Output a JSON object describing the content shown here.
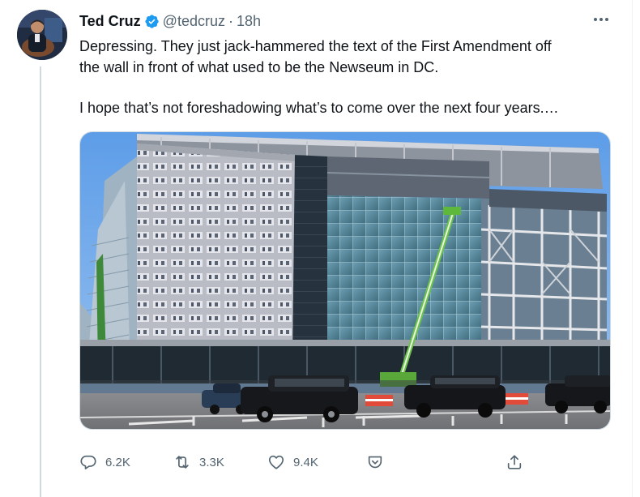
{
  "tweet": {
    "author_name": "Ted Cruz",
    "handle": "@tedcruz",
    "separator": "·",
    "time": "18h",
    "verified": true,
    "text_lines": [
      "Depressing.  They just jack-hammered the text of the First Amendment off",
      "the wall in front of what used to be the Newseum in DC."
    ],
    "text_line_2": "I hope that’s not foreshadowing what’s to come over the next four years.…"
  },
  "actions": {
    "reply_count": "6.2K",
    "retweet_count": "3.3K",
    "like_count": "9.4K"
  },
  "icons": {
    "verified": "verified-badge-icon",
    "more": "more-options-icon",
    "reply": "reply-icon",
    "retweet": "retweet-icon",
    "like": "heart-icon",
    "tip": "tip-icon",
    "share": "share-icon"
  },
  "colors": {
    "accent": "#1d9bf0",
    "text_primary": "#0f1419",
    "text_secondary": "#536471",
    "divider": "#cfd9de"
  }
}
